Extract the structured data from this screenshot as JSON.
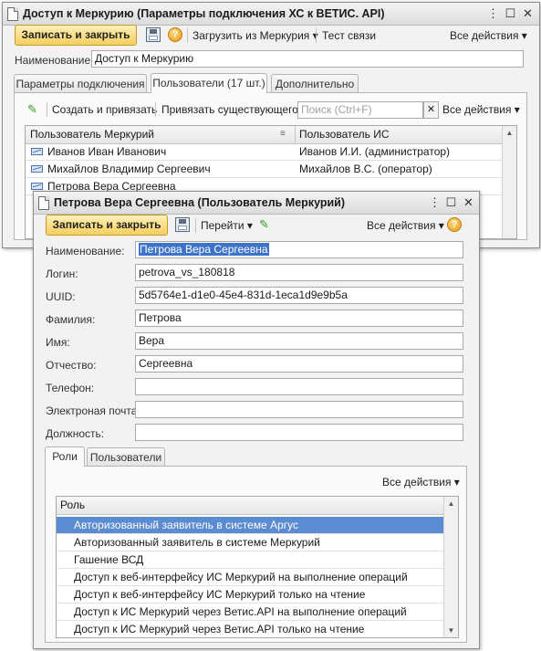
{
  "back_window": {
    "title": "Доступ к Меркурию (Параметры подключения ХС к ВЕТИС. API)",
    "toolbar": {
      "save_close": "Записать и закрыть",
      "load": "Загрузить из Меркурия ▾",
      "test": "Тест связи",
      "all_actions": "Все действия ▾"
    },
    "name_label": "Наименование:",
    "name_value": "Доступ к Меркурию",
    "tabs": [
      "Параметры подключения",
      "Пользователи (17 шт.)",
      "Дополнительно"
    ],
    "users_toolbar": {
      "create_bind": "Создать и привязать",
      "bind_existing": "Привязать существующего",
      "search_placeholder": "Поиск (Ctrl+F)",
      "all_actions": "Все действия ▾"
    },
    "table": {
      "headers": [
        "Пользователь Меркурий",
        "Пользователь ИС"
      ],
      "rows": [
        {
          "mercury": "Иванов Иван Иванович",
          "is": "Иванов И.И. (администратор)"
        },
        {
          "mercury": "Михайлов Владимир Сергеевич",
          "is": "Михайлов В.С. (оператор)"
        },
        {
          "mercury": "Петрова Вера Сергеевна",
          "is": ""
        }
      ]
    }
  },
  "front_window": {
    "title": "Петрова Вера Сергеевна (Пользователь Меркурий)",
    "toolbar": {
      "save_close": "Записать и закрыть",
      "goto": "Перейти ▾",
      "all_actions": "Все действия ▾"
    },
    "fields": [
      {
        "label": "Наименование:",
        "value": "Петрова Вера Сергеевна"
      },
      {
        "label": "Логин:",
        "value": "petrova_vs_180818"
      },
      {
        "label": "UUID:",
        "value": "5d5764e1-d1e0-45e4-831d-1eca1d9e9b5a"
      },
      {
        "label": "Фамилия:",
        "value": "Петрова"
      },
      {
        "label": "Имя:",
        "value": "Вера"
      },
      {
        "label": "Отчество:",
        "value": "Сергеевна"
      },
      {
        "label": "Телефон:",
        "value": ""
      },
      {
        "label": "Электроная почта:",
        "value": ""
      },
      {
        "label": "Должность:",
        "value": ""
      }
    ],
    "tabs": [
      "Роли",
      "Пользователи"
    ],
    "roles_all_actions": "Все действия ▾",
    "roles": {
      "header": "Роль",
      "rows": [
        "Авторизованный заявитель в системе Аргус",
        "Авторизованный заявитель в системе Меркурий",
        "Гашение ВСД",
        "Доступ к веб-интерфейсу ИС Меркурий на выполнение операций",
        "Доступ к веб-интерфейсу ИС Меркурий только на чтение",
        "Доступ к ИС Меркурий через Ветис.API на выполнение операций",
        "Доступ к ИС Меркурий через Ветис.API только на чтение"
      ]
    }
  },
  "colors": {
    "accent_button": "#f5cf5e",
    "selection": "#5b8bd0"
  }
}
